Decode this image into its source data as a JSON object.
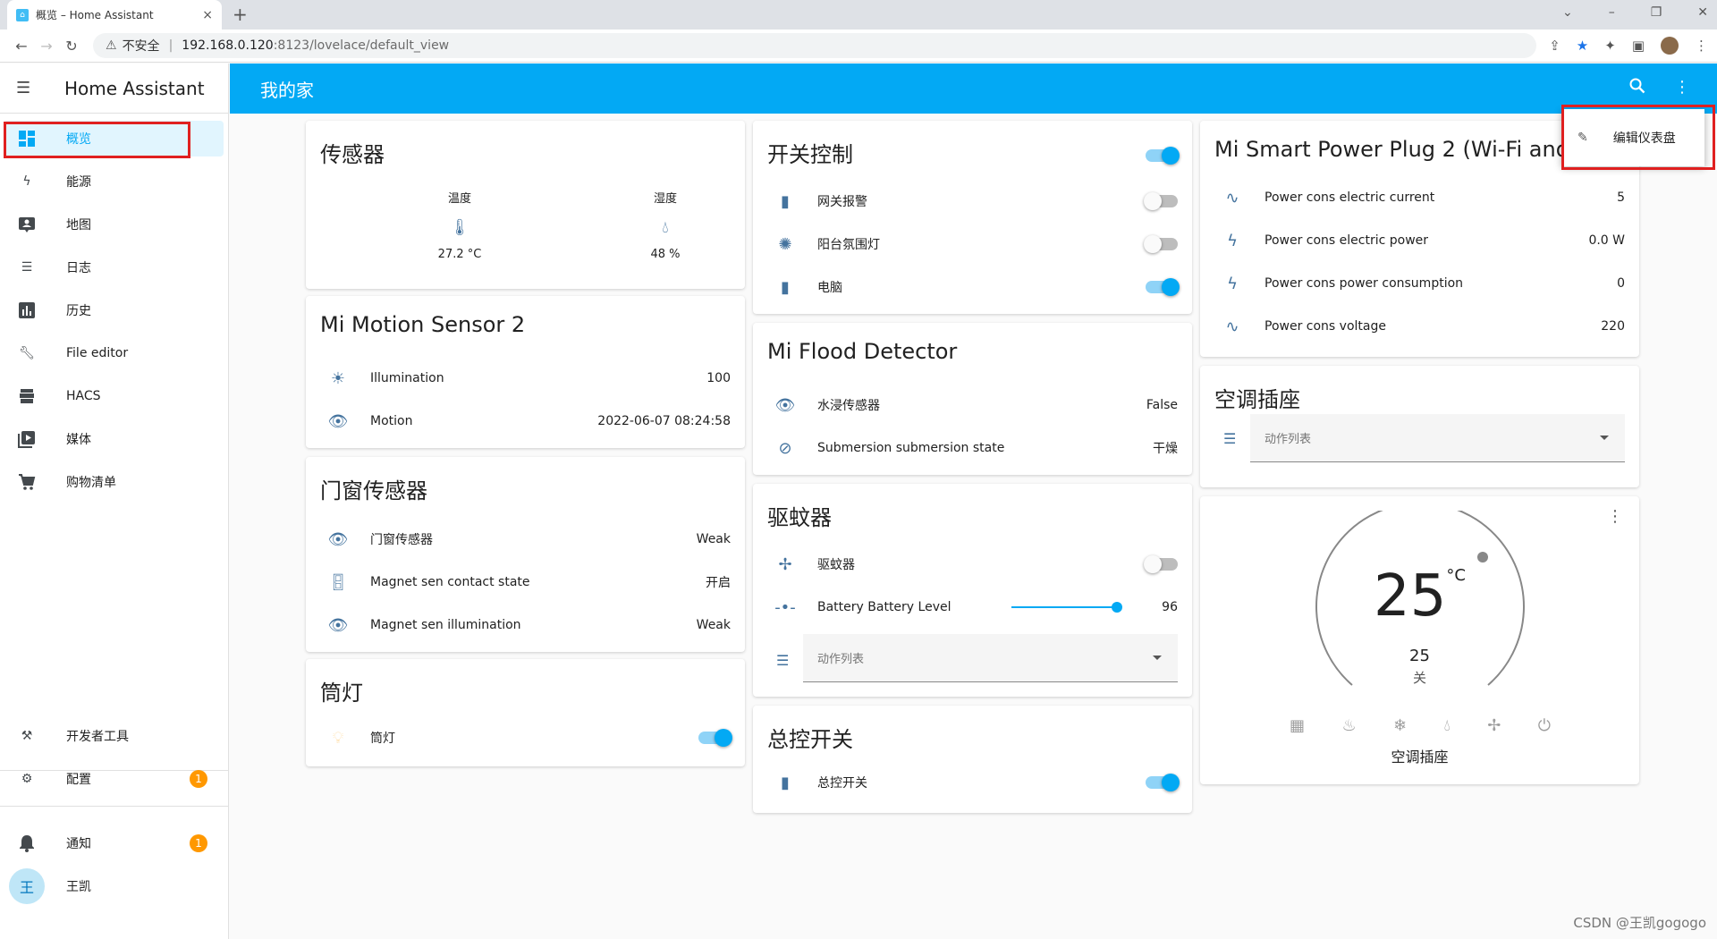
{
  "browser": {
    "tab_title": "概览 – Home Assistant",
    "tab_close": "×",
    "new_tab": "+",
    "insecure_label": "不安全",
    "url_host": "192.168.0.120",
    "url_path": ":8123/lovelace/default_view",
    "window_controls": [
      "⌄",
      "–",
      "❐",
      "✕"
    ]
  },
  "sidebar": {
    "title": "Home Assistant",
    "items": [
      {
        "label": "概览",
        "icon": "dashboard-icon",
        "active": true
      },
      {
        "label": "能源",
        "icon": "lightning-icon"
      },
      {
        "label": "地图",
        "icon": "map-person-icon"
      },
      {
        "label": "日志",
        "icon": "list-icon"
      },
      {
        "label": "历史",
        "icon": "chart-icon"
      },
      {
        "label": "File editor",
        "icon": "wrench-icon"
      },
      {
        "label": "HACS",
        "icon": "hacs-icon"
      },
      {
        "label": "媒体",
        "icon": "play-box-icon"
      },
      {
        "label": "购物清单",
        "icon": "cart-icon"
      }
    ],
    "dev_tools": "开发者工具",
    "config": "配置",
    "config_badge": "1",
    "notifications": "通知",
    "notifications_badge": "1",
    "user_initial": "王",
    "user_name": "王凯"
  },
  "topbar": {
    "title": "我的家"
  },
  "dropdown": {
    "edit_dashboard": "编辑仪表盘"
  },
  "cards": {
    "sensors": {
      "title": "传感器",
      "temp_label": "温度",
      "temp_value": "27.2 °C",
      "humid_label": "湿度",
      "humid_value": "48 %"
    },
    "motion": {
      "title": "Mi Motion Sensor 2",
      "rows": [
        {
          "label": "Illumination",
          "value": "100"
        },
        {
          "label": "Motion",
          "value": "2022-06-07 08:24:58"
        }
      ]
    },
    "door": {
      "title": "门窗传感器",
      "rows": [
        {
          "label": "门窗传感器",
          "value": "Weak"
        },
        {
          "label": "Magnet sen contact state",
          "value": "开启"
        },
        {
          "label": "Magnet sen illumination",
          "value": "Weak"
        }
      ]
    },
    "downlight": {
      "title": "筒灯",
      "row_label": "筒灯",
      "on": true
    },
    "switches": {
      "title": "开关控制",
      "rows": [
        {
          "label": "网关报警",
          "on": false
        },
        {
          "label": "阳台氛围灯",
          "on": false
        },
        {
          "label": "电脑",
          "on": true
        }
      ]
    },
    "flood": {
      "title": "Mi Flood Detector",
      "rows": [
        {
          "label": "水浸传感器",
          "value": "False"
        },
        {
          "label": "Submersion submersion state",
          "value": "干燥"
        }
      ]
    },
    "mosquito": {
      "title": "驱蚊器",
      "switch_label": "驱蚊器",
      "battery_label": "Battery Battery Level",
      "battery_value": "96",
      "battery_level": 96,
      "select_placeholder": "动作列表"
    },
    "master": {
      "title": "总控开关",
      "row_label": "总控开关",
      "on": true
    },
    "plug": {
      "title": "Mi Smart Power Plug 2 (Wi-Fi and Blu",
      "rows": [
        {
          "label": "Power cons electric current",
          "value": "5"
        },
        {
          "label": "Power cons electric power",
          "value": "0.0 W"
        },
        {
          "label": "Power cons power consumption",
          "value": "0"
        },
        {
          "label": "Power cons voltage",
          "value": "220"
        }
      ]
    },
    "ac": {
      "title": "空调插座",
      "select_placeholder": "动作列表"
    },
    "thermostat": {
      "target": "25",
      "unit": "°C",
      "current": "25",
      "state": "关",
      "name": "空调插座",
      "modes": [
        "calendar-sync-icon",
        "fire-icon",
        "snowflake-icon",
        "water-icon",
        "fan-icon",
        "power-icon"
      ]
    }
  },
  "watermark": "CSDN @王凯gogogo",
  "colors": {
    "accent": "#03a9f4",
    "icon": "#44739e",
    "badge": "#ff9800",
    "highlight": "#e02020"
  }
}
